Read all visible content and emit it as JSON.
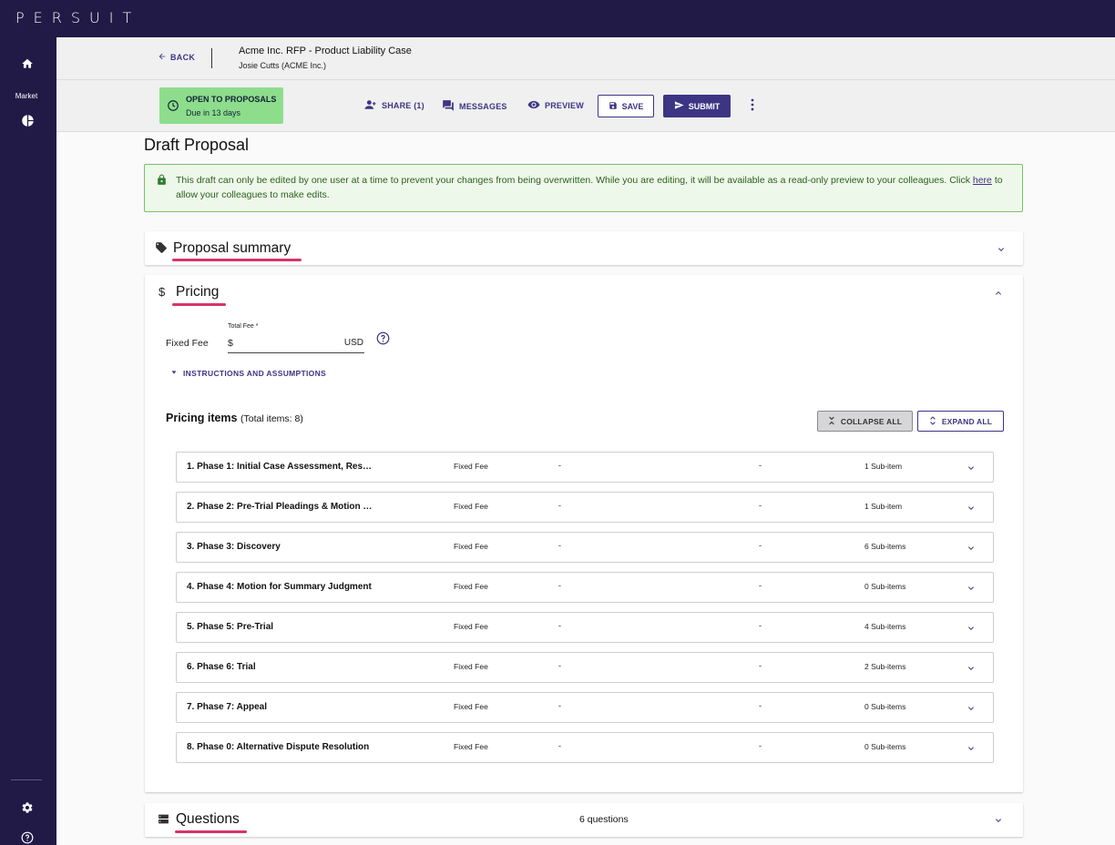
{
  "app": {
    "logo_text": "PERSUIT"
  },
  "sidebar": {
    "items": [
      {
        "icon": "home-icon",
        "label": ""
      },
      {
        "icon": "pie-chart-icon",
        "label": "Market"
      }
    ],
    "bottom": [
      {
        "icon": "gear-icon"
      },
      {
        "icon": "help-icon"
      }
    ]
  },
  "header": {
    "back_label": "BACK",
    "title": "Acme Inc. RFP - Product Liability Case",
    "subtitle": "Josie Cutts (ACME Inc.)",
    "status": {
      "title": "OPEN TO PROPOSALS",
      "subtitle": "Due in 13 days",
      "color": "#8ddd8d"
    },
    "actions": {
      "share": "SHARE (1)",
      "messages": "MESSAGES",
      "preview": "PREVIEW",
      "save": "SAVE",
      "submit": "SUBMIT"
    }
  },
  "page": {
    "title": "Draft Proposal",
    "notice": {
      "text_before": "This draft can only be edited by one user at a time to prevent your changes from being overwritten. While you are editing, it will be available as a read-only preview to your colleagues. Click",
      "link": "here",
      "text_after": "to allow your colleagues to make edits."
    }
  },
  "sections": {
    "proposal_summary": {
      "title": "Proposal summary"
    },
    "pricing": {
      "title": "Pricing",
      "fee_type": "Fixed Fee",
      "total_fee_label": "Total Fee *",
      "currency_symbol": "$",
      "currency": "USD",
      "total_fee_value": "",
      "instructions_label": "INSTRUCTIONS AND ASSUMPTIONS",
      "items_title": "Pricing items",
      "items_count": "(Total items: 8)",
      "collapse_all": "COLLAPSE ALL",
      "expand_all": "EXPAND ALL",
      "items": [
        {
          "name": "1. Phase 1: Initial Case Assessment, Res…",
          "type": "Fixed Fee",
          "col1": "-",
          "col2": "-",
          "subitems": "1 Sub-item"
        },
        {
          "name": "2. Phase 2: Pre-Trial Pleadings & Motion …",
          "type": "Fixed Fee",
          "col1": "-",
          "col2": "-",
          "subitems": "1 Sub-item"
        },
        {
          "name": "3. Phase 3: Discovery",
          "type": "Fixed Fee",
          "col1": "-",
          "col2": "-",
          "subitems": "6 Sub-items"
        },
        {
          "name": "4. Phase 4: Motion for Summary Judgment",
          "type": "Fixed Fee",
          "col1": "-",
          "col2": "-",
          "subitems": "0 Sub-items"
        },
        {
          "name": "5. Phase 5: Pre-Trial",
          "type": "Fixed Fee",
          "col1": "-",
          "col2": "-",
          "subitems": "4 Sub-items"
        },
        {
          "name": "6. Phase 6: Trial",
          "type": "Fixed Fee",
          "col1": "-",
          "col2": "-",
          "subitems": "2 Sub-items"
        },
        {
          "name": "7. Phase 7: Appeal",
          "type": "Fixed Fee",
          "col1": "-",
          "col2": "-",
          "subitems": "0 Sub-items"
        },
        {
          "name": "8. Phase 0: Alternative Dispute Resolution",
          "type": "Fixed Fee",
          "col1": "-",
          "col2": "-",
          "subitems": "0 Sub-items"
        }
      ]
    },
    "questions": {
      "title": "Questions",
      "count": "6 questions"
    }
  },
  "colors": {
    "brand_dark": "#211a47",
    "accent": "#3c3584",
    "highlight": "#d6336c"
  }
}
